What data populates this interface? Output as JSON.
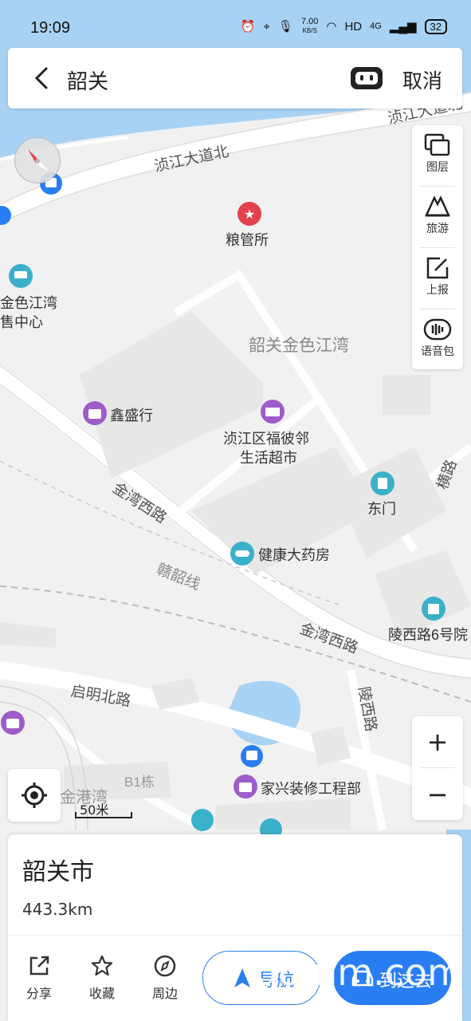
{
  "status": {
    "time": "19:09",
    "net_speed": "7.00",
    "net_unit": "KB/S",
    "hd": "HD",
    "signal": "4G",
    "battery": "32"
  },
  "search": {
    "query": "韶关",
    "cancel_label": "取消"
  },
  "tools": [
    {
      "label": "图层",
      "icon": "layers-icon"
    },
    {
      "label": "旅游",
      "icon": "travel-icon"
    },
    {
      "label": "上报",
      "icon": "report-icon"
    },
    {
      "label": "语音包",
      "icon": "voice-pack-icon"
    }
  ],
  "zoom": {
    "in": "+",
    "out": "−"
  },
  "scale_label": "50米",
  "map": {
    "roads": [
      "浈江大道北",
      "浈江大道北",
      "金湾西路",
      "金湾西路",
      "赣韶线",
      "启明北路",
      "陵西路",
      "横路"
    ],
    "area_label": "韶关金色江湾",
    "pois": [
      {
        "name": "粮管所"
      },
      {
        "name": "金色江湾"
      },
      {
        "name": "售中心"
      },
      {
        "name": "鑫盛行"
      },
      {
        "name": "浈江区福彼邻"
      },
      {
        "name": "生活超市"
      },
      {
        "name": "东门"
      },
      {
        "name": "健康大药房"
      },
      {
        "name": "陵西路6号院"
      },
      {
        "name": "家兴装修工程部"
      },
      {
        "name": "金港湾"
      },
      {
        "name": "B1栋"
      }
    ]
  },
  "card": {
    "title": "韶关市",
    "distance": "443.3km",
    "actions": [
      {
        "label": "分享",
        "icon": "share-icon"
      },
      {
        "label": "收藏",
        "icon": "star-icon"
      },
      {
        "label": "周边",
        "icon": "compass-icon"
      }
    ],
    "nav_label": "导航",
    "arrive_label": "到这去"
  },
  "watermark": "gdmm.com",
  "colors": {
    "accent": "#2a7ef4",
    "water": "#a8d2f3",
    "poi_red": "#e2414d",
    "poi_purple": "#9d5cc9",
    "poi_teal": "#3bb1c9"
  }
}
